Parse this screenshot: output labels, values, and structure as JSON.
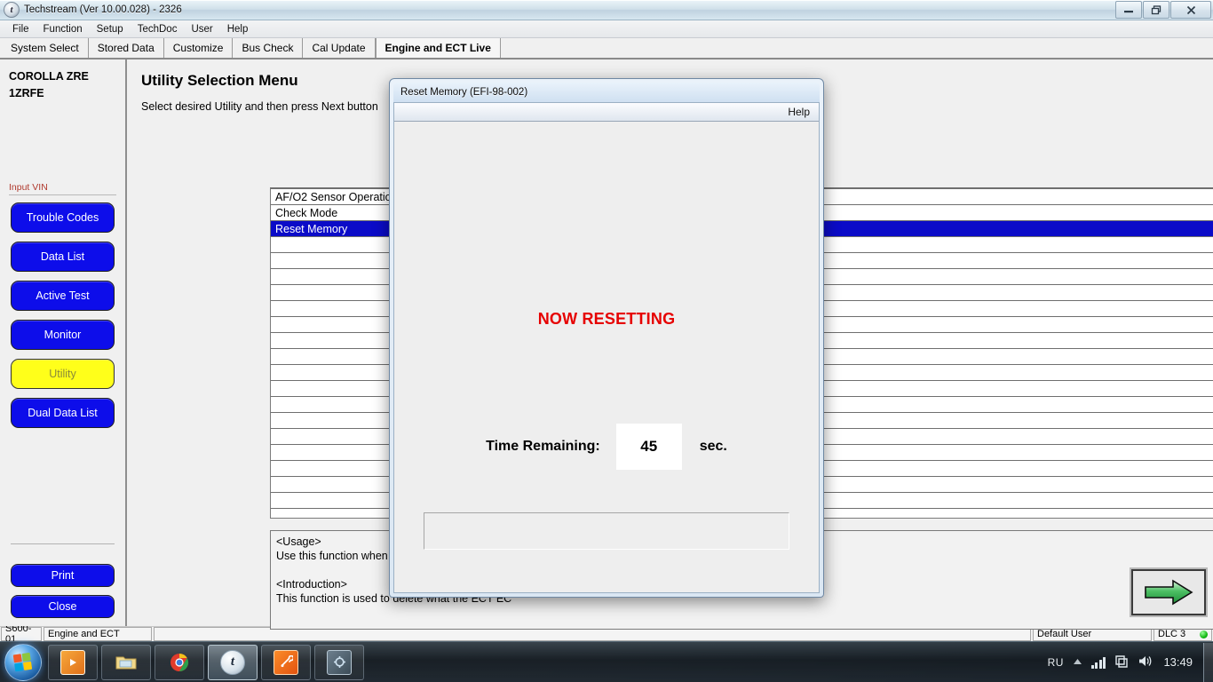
{
  "window": {
    "title": "Techstream (Ver 10.00.028) - 2326",
    "app_icon": "techstream-icon",
    "buttons": {
      "minimize": "—",
      "restore": "❐",
      "close": "✕"
    }
  },
  "menubar": {
    "items": [
      "File",
      "Function",
      "Setup",
      "TechDoc",
      "User",
      "Help"
    ]
  },
  "tabs": [
    {
      "label": "System Select",
      "active": false
    },
    {
      "label": "Stored Data",
      "active": false
    },
    {
      "label": "Customize",
      "active": false
    },
    {
      "label": "Bus Check",
      "active": false
    },
    {
      "label": "Cal Update",
      "active": false
    },
    {
      "label": "Engine and ECT Live",
      "active": true
    }
  ],
  "sidebar": {
    "vehicle_line1": "COROLLA ZRE",
    "vehicle_line2": "1ZRFE",
    "vin_label": "Input VIN",
    "buttons": [
      {
        "label": "Trouble Codes",
        "style": "blue"
      },
      {
        "label": "Data List",
        "style": "blue"
      },
      {
        "label": "Active Test",
        "style": "blue"
      },
      {
        "label": "Monitor",
        "style": "blue"
      },
      {
        "label": "Utility",
        "style": "yellow"
      },
      {
        "label": "Dual Data List",
        "style": "blue"
      }
    ],
    "bottom_buttons": [
      {
        "label": "Print"
      },
      {
        "label": "Close"
      }
    ]
  },
  "content": {
    "title": "Utility Selection Menu",
    "subtitle": "Select desired Utility and then press Next button",
    "list_items": [
      {
        "label": "AF/O2 Sensor Operation",
        "selected": false
      },
      {
        "label": "Check Mode",
        "selected": false
      },
      {
        "label": "Reset Memory",
        "selected": true
      },
      {
        "label": "",
        "selected": false
      },
      {
        "label": "",
        "selected": false
      },
      {
        "label": "",
        "selected": false
      },
      {
        "label": "",
        "selected": false
      },
      {
        "label": "",
        "selected": false
      },
      {
        "label": "",
        "selected": false
      },
      {
        "label": "",
        "selected": false
      },
      {
        "label": "",
        "selected": false
      },
      {
        "label": "",
        "selected": false
      },
      {
        "label": "",
        "selected": false
      },
      {
        "label": "",
        "selected": false
      },
      {
        "label": "",
        "selected": false
      },
      {
        "label": "",
        "selected": false
      },
      {
        "label": "",
        "selected": false
      },
      {
        "label": "",
        "selected": false
      },
      {
        "label": "",
        "selected": false
      },
      {
        "label": "",
        "selected": false
      }
    ],
    "description": "<Usage>\nUse this function when the automatic transaxle\n\n<Introduction>\nThis function is used to delete what the ECT EC",
    "next_button": "next-arrow"
  },
  "dialog": {
    "title": "Reset Memory (EFI-98-002)",
    "help_label": "Help",
    "status_text": "NOW RESETTING",
    "time_label": "Time Remaining:",
    "time_value": "45",
    "time_unit": "sec.",
    "status_color": "#e60000"
  },
  "statusbar": {
    "code": "S600-01",
    "system": "Engine and ECT",
    "blank": "",
    "user": "Default User",
    "dlc": "DLC 3",
    "dlc_status_color": "#14b914"
  },
  "taskbar": {
    "start_label": "start-orb",
    "items": [
      {
        "name": "media-player-icon",
        "active": false
      },
      {
        "name": "file-explorer-icon",
        "active": false
      },
      {
        "name": "chrome-icon",
        "active": false
      },
      {
        "name": "techstream-icon",
        "active": true
      },
      {
        "name": "orange-tool-icon",
        "active": false
      },
      {
        "name": "blue-tool-icon",
        "active": false
      }
    ],
    "tray": {
      "language": "RU",
      "caret": "▲",
      "network_icon": "signal-bars-icon",
      "action-center": "flag-icon",
      "volume_icon": "speaker-icon",
      "clock": "13:49"
    }
  }
}
